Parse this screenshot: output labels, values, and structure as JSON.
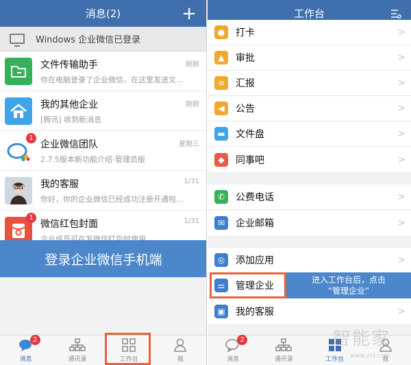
{
  "left": {
    "title": "消息(2)",
    "plus_glyph": "+",
    "pc_login": "Windows 企业微信已登录",
    "conversations": [
      {
        "name": "文件传输助手",
        "preview": "你在电脑登录了企业微信，在这里发送文...",
        "time": "刚刚",
        "badge": "",
        "icon": "folder-icon",
        "color": "#35b259"
      },
      {
        "name": "我的其他企业",
        "preview": "[腾讯] 收到新消息",
        "time": "刚刚",
        "badge": "",
        "icon": "home-icon",
        "color": "#3fa4e8"
      },
      {
        "name": "企业微信团队",
        "preview": "2.7.5版本新功能介绍-管理员版",
        "time": "星期三",
        "badge": "1",
        "icon": "wework-logo-icon",
        "color": "#ffffff"
      },
      {
        "name": "我的客服",
        "preview": "你好，你的企业微信已经成功注册开通啦...",
        "time": "1/31",
        "badge": "",
        "icon": "avatar-photo",
        "color": "#d9c7b5"
      },
      {
        "name": "微信红包封面",
        "preview": "企业成员可在发微信红包时使用",
        "time": "1/31",
        "badge": "1",
        "icon": "red-packet-icon",
        "color": "#e8513f"
      }
    ],
    "banner": "登录企业微信手机端",
    "tabs": [
      {
        "label": "消息",
        "badge": "2",
        "icon": "chat-icon"
      },
      {
        "label": "通讯录",
        "badge": "",
        "icon": "org-chart-icon"
      },
      {
        "label": "工作台",
        "badge": "",
        "icon": "grid-icon"
      },
      {
        "label": "我",
        "badge": "",
        "icon": "person-icon"
      }
    ]
  },
  "right": {
    "title": "工作台",
    "groups": [
      [
        {
          "label": "打卡",
          "icon": "location-icon",
          "color": "#f0a92e"
        },
        {
          "label": "审批",
          "icon": "stamp-icon",
          "color": "#f0a92e"
        },
        {
          "label": "汇报",
          "icon": "report-icon",
          "color": "#f0a92e"
        },
        {
          "label": "公告",
          "icon": "megaphone-icon",
          "color": "#f0a92e"
        },
        {
          "label": "文件盘",
          "icon": "disk-icon",
          "color": "#3fa4e8"
        },
        {
          "label": "同事吧",
          "icon": "share-icon",
          "color": "#ea5a47"
        }
      ],
      [
        {
          "label": "公费电话",
          "icon": "phone-icon",
          "color": "#35b259"
        },
        {
          "label": "企业邮箱",
          "icon": "mail-icon",
          "color": "#3f7ecf"
        }
      ],
      [
        {
          "label": "添加应用",
          "icon": "compass-icon",
          "color": "#3f7ecf"
        },
        {
          "label": "管理企业",
          "icon": "sliders-icon",
          "color": "#3f7ecf"
        },
        {
          "label": "我的客服",
          "icon": "contact-card-icon",
          "color": "#3f7ecf"
        }
      ]
    ],
    "callout_line1": "进入工作台后，点击",
    "callout_line2": "“管理企业”",
    "tabs": [
      {
        "label": "消息",
        "badge": "2",
        "icon": "chat-icon"
      },
      {
        "label": "通讯录",
        "badge": "",
        "icon": "org-chart-icon"
      },
      {
        "label": "工作台",
        "badge": "",
        "icon": "grid-icon"
      },
      {
        "label": "我",
        "badge": "",
        "icon": "person-icon"
      }
    ],
    "watermark": "智能家",
    "watermark_url": "www.znj.com"
  },
  "colors": {
    "nav": "#3f6fad",
    "banner": "#4d87cb",
    "highlight": "#e8603a",
    "badge": "#e4393c"
  }
}
